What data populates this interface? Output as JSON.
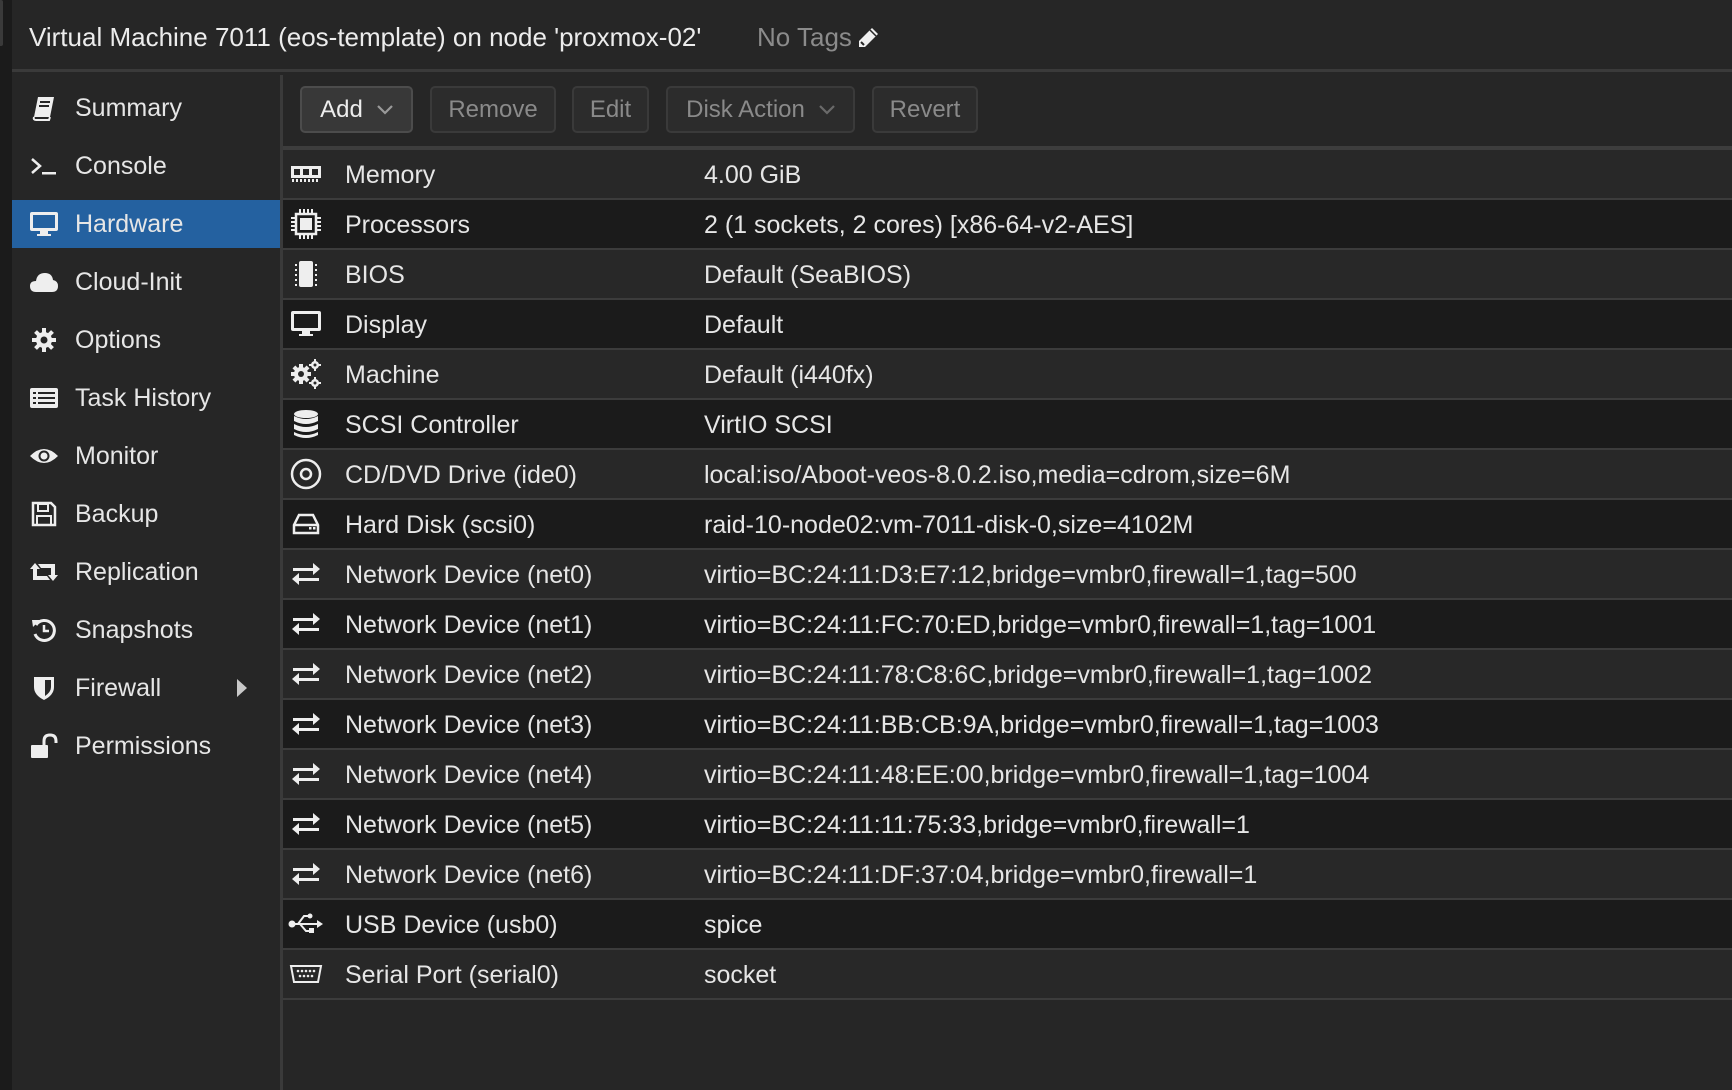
{
  "header": {
    "title": "Virtual Machine 7011 (eos-template) on node 'proxmox-02'",
    "tags_label": "No Tags",
    "tags_edit_icon": "pencil-icon"
  },
  "colors": {
    "background": "#262626",
    "selected_nav": "#2461a0",
    "row_odd": "#282828",
    "row_even": "#1b1b1b",
    "disabled_text": "#8a8a8a"
  },
  "sidebar": {
    "items": [
      {
        "label": "Summary",
        "icon": "book-icon",
        "active": false
      },
      {
        "label": "Console",
        "icon": "terminal-icon",
        "active": false
      },
      {
        "label": "Hardware",
        "icon": "desktop-icon",
        "active": true
      },
      {
        "label": "Cloud-Init",
        "icon": "cloud-icon",
        "active": false
      },
      {
        "label": "Options",
        "icon": "gear-icon",
        "active": false
      },
      {
        "label": "Task History",
        "icon": "list-icon",
        "active": false
      },
      {
        "label": "Monitor",
        "icon": "eye-icon",
        "active": false
      },
      {
        "label": "Backup",
        "icon": "floppy-icon",
        "active": false
      },
      {
        "label": "Replication",
        "icon": "retweet-icon",
        "active": false
      },
      {
        "label": "Snapshots",
        "icon": "history-icon",
        "active": false
      },
      {
        "label": "Firewall",
        "icon": "shield-icon",
        "active": false,
        "expandable": true
      },
      {
        "label": "Permissions",
        "icon": "unlock-icon",
        "active": false
      }
    ]
  },
  "toolbar": {
    "add_label": "Add",
    "remove_label": "Remove",
    "edit_label": "Edit",
    "disk_action_label": "Disk Action",
    "revert_label": "Revert"
  },
  "hardware": {
    "rows": [
      {
        "name": "Memory",
        "value": "4.00 GiB",
        "icon": "memory-icon"
      },
      {
        "name": "Processors",
        "value": "2 (1 sockets, 2 cores) [x86-64-v2-AES]",
        "icon": "cpu-icon"
      },
      {
        "name": "BIOS",
        "value": "Default (SeaBIOS)",
        "icon": "chip-icon"
      },
      {
        "name": "Display",
        "value": "Default",
        "icon": "desktop-icon"
      },
      {
        "name": "Machine",
        "value": "Default (i440fx)",
        "icon": "gears-icon"
      },
      {
        "name": "SCSI Controller",
        "value": "VirtIO SCSI",
        "icon": "database-icon"
      },
      {
        "name": "CD/DVD Drive (ide0)",
        "value": "local:iso/Aboot-veos-8.0.2.iso,media=cdrom,size=6M",
        "icon": "cdrom-icon"
      },
      {
        "name": "Hard Disk (scsi0)",
        "value": "raid-10-node02:vm-7011-disk-0,size=4102M",
        "icon": "hdd-icon"
      },
      {
        "name": "Network Device (net0)",
        "value": "virtio=BC:24:11:D3:E7:12,bridge=vmbr0,firewall=1,tag=500",
        "icon": "exchange-icon"
      },
      {
        "name": "Network Device (net1)",
        "value": "virtio=BC:24:11:FC:70:ED,bridge=vmbr0,firewall=1,tag=1001",
        "icon": "exchange-icon"
      },
      {
        "name": "Network Device (net2)",
        "value": "virtio=BC:24:11:78:C8:6C,bridge=vmbr0,firewall=1,tag=1002",
        "icon": "exchange-icon"
      },
      {
        "name": "Network Device (net3)",
        "value": "virtio=BC:24:11:BB:CB:9A,bridge=vmbr0,firewall=1,tag=1003",
        "icon": "exchange-icon"
      },
      {
        "name": "Network Device (net4)",
        "value": "virtio=BC:24:11:48:EE:00,bridge=vmbr0,firewall=1,tag=1004",
        "icon": "exchange-icon"
      },
      {
        "name": "Network Device (net5)",
        "value": "virtio=BC:24:11:11:75:33,bridge=vmbr0,firewall=1",
        "icon": "exchange-icon"
      },
      {
        "name": "Network Device (net6)",
        "value": "virtio=BC:24:11:DF:37:04,bridge=vmbr0,firewall=1",
        "icon": "exchange-icon"
      },
      {
        "name": "USB Device (usb0)",
        "value": "spice",
        "icon": "usb-icon"
      },
      {
        "name": "Serial Port (serial0)",
        "value": "socket",
        "icon": "serial-port-icon"
      }
    ]
  }
}
